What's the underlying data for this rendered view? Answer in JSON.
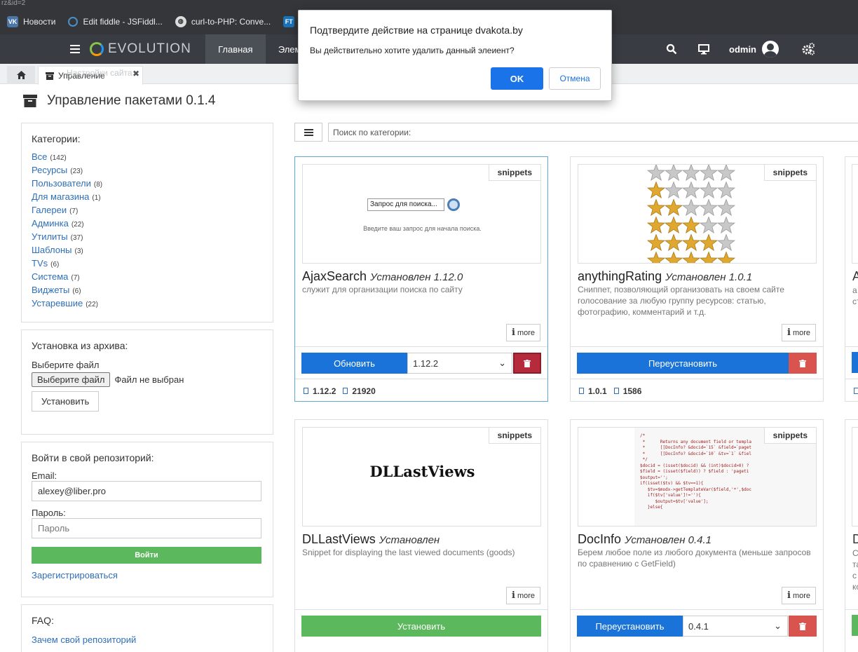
{
  "browser": {
    "url_fragment": "rz&id=2",
    "bookmarks": [
      {
        "icon": "vk-icon",
        "label": "Новости"
      },
      {
        "icon": "jsfiddle-icon",
        "label": "Edit fiddle - JSFiddl..."
      },
      {
        "icon": "globe-icon",
        "label": "curl-to-PHP: Conve..."
      },
      {
        "icon": "ft-icon",
        "label": "FT"
      }
    ]
  },
  "header": {
    "logo": "EVOLUTION",
    "nav": [
      "Главная",
      "Элем"
    ],
    "user": "odmin"
  },
  "tabs": {
    "active": "Управление",
    "ghost": "Настройки сайта"
  },
  "page": {
    "title": "Управление пакетами 0.1.4"
  },
  "categories": {
    "heading": "Категории:",
    "items": [
      {
        "label": "Все",
        "count": "(142)"
      },
      {
        "label": "Ресурсы",
        "count": "(23)"
      },
      {
        "label": "Пользователи",
        "count": "(8)"
      },
      {
        "label": "Для магазина",
        "count": "(1)"
      },
      {
        "label": "Галереи",
        "count": "(7)"
      },
      {
        "label": "Админка",
        "count": "(22)"
      },
      {
        "label": "Утилиты",
        "count": "(37)"
      },
      {
        "label": "Шаблоны",
        "count": "(3)"
      },
      {
        "label": "TVs",
        "count": "(6)"
      },
      {
        "label": "Система",
        "count": "(7)"
      },
      {
        "label": "Виджеты",
        "count": "(6)"
      },
      {
        "label": "Устаревшие",
        "count": "(22)"
      }
    ]
  },
  "archive": {
    "heading": "Установка из архива:",
    "choose_label": "Выберите файл",
    "choose_button": "Выберите файл",
    "no_file": "Файл не выбран",
    "install_button": "Установить"
  },
  "repo": {
    "heading": "Войти в свой репозиторий:",
    "email_label": "Email:",
    "email_value": "alexey@liber.pro",
    "password_label": "Пароль:",
    "password_placeholder": "Пароль",
    "login_button": "Войти",
    "register_link": "Зарегистрироваться"
  },
  "faq": {
    "heading": "FAQ:",
    "link1": "Зачем свой репозиторий"
  },
  "search": {
    "placeholder": "Поиск по категории:"
  },
  "cards": {
    "ajax": {
      "badge": "snippets",
      "name": "AjaxSearch",
      "status": "Установлен 1.12.0",
      "desc": "служит для организации поиска по сайту",
      "more": "more",
      "action": "Обновить",
      "version": "1.12.2",
      "stat_version": "1.12.2",
      "downloads": "21920",
      "thumb_input": "Запрос для поиска...",
      "thumb_hint": "Введите ваш запрос для начала поиска."
    },
    "rating": {
      "badge": "snippets",
      "name": "anythingRating",
      "status": "Установлен 1.0.1",
      "desc": "Сниппет, позволяющий организовать на своем сайте голосование за любую группу ресурсов: статью, фотографию, комментарий и т.д.",
      "more": "more",
      "action": "Переустановить",
      "stat_version": "1.0.1",
      "downloads": "1586",
      "stars": [
        0,
        1,
        2,
        3,
        4,
        5
      ]
    },
    "dll": {
      "badge": "snippets",
      "name": "DLLastViews",
      "status": "Установлен",
      "desc": "Snippet for displaying the last viewed documents (goods)",
      "more": "more",
      "action": "Установить",
      "thumb_text": "DLLastViews"
    },
    "docinfo": {
      "badge": "snippets",
      "name": "DocInfo",
      "status": "Установлен 0.4.1",
      "desc": "Берем любое поле из любого документа (меньше запросов по сравнению с GetField)",
      "more": "more",
      "action": "Переустановить",
      "version": "0.4.1",
      "code": "/*\n *      Returns any document field or templa\n *      [[DocInfo? &docid=`15` &field=`paget\n *      [[DocInfo? &docid=`10` &tv=`1` &fiel\n */\n$docid = (isset($docid) && (int)$docid>0) ?\n$field = (isset($field)) ? $field : 'pageti\n$output='';\nif(isset($tv) && $tv==1){\n   $tv=$modx->getTemplateVar($field,'*',$doc\n   if($tv['value']!=''){\n      $output=$tv['value'];\n   }else{"
    }
  },
  "partial_cards": {
    "top_letter": "A",
    "top_lines": [
      "а",
      "ст"
    ],
    "bottom_letter": "D",
    "bottom_lines": [
      "С",
      "та",
      "с",
      "ко"
    ]
  },
  "dialog": {
    "title": "Подтвердите действие на странице dvakota.by",
    "message": "Вы действительно хотите удалить данный элеиент?",
    "ok": "OK",
    "cancel": "Отмена"
  },
  "colors": {
    "header_bg": "#393d43",
    "link": "#2e6fb7",
    "primary_blue": "#1a73d9",
    "success_green": "#5cb85c",
    "danger_red": "#d9534f",
    "star_gold": "#e0a82e",
    "star_grey": "#c8c8c8"
  }
}
